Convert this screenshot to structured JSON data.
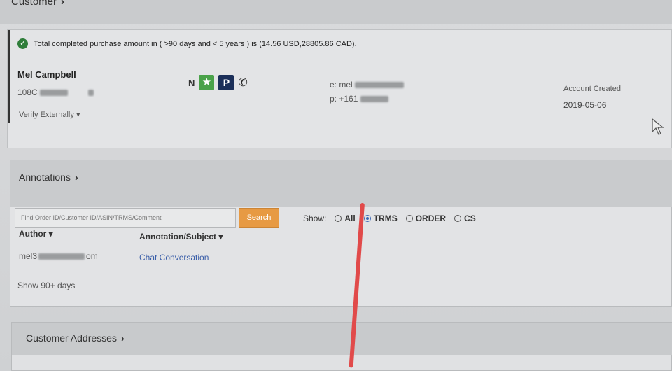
{
  "customer_section": {
    "title": "Customer"
  },
  "customer": {
    "notice": "Total completed purchase amount in ( >90 days and < 5 years ) is (14.56 USD,28805.86 CAD).",
    "name": "Mel Campbell",
    "id_prefix": "108C",
    "verify": "Verify Externally",
    "badge_n": "N",
    "badge_star": "★",
    "badge_p": "P",
    "email_prefix": "e: mel",
    "phone_prefix": "p: +161",
    "account_created_label": "Account Created",
    "account_created_date": "2019-05-06"
  },
  "annotations": {
    "title": "Annotations",
    "search_placeholder": "Find Order ID/Customer ID/ASIN/TRMS/Comment",
    "search_button": "Search",
    "show_label": "Show:",
    "filters": [
      "All",
      "TRMS",
      "ORDER",
      "CS"
    ],
    "selected_filter": "TRMS",
    "columns": {
      "author": "Author",
      "subject": "Annotation/Subject"
    },
    "rows": [
      {
        "author_prefix": "mel3",
        "author_suffix": "om",
        "subject": "Chat Conversation"
      }
    ],
    "show_more": "Show 90+ days"
  },
  "addresses": {
    "title": "Customer Addresses"
  },
  "colors": {
    "search_button": "#e79a43",
    "badge_star": "#4aa24a",
    "badge_p": "#1b2f59",
    "link": "#3a5ea8",
    "annotation_mark": "#e14a4a"
  }
}
